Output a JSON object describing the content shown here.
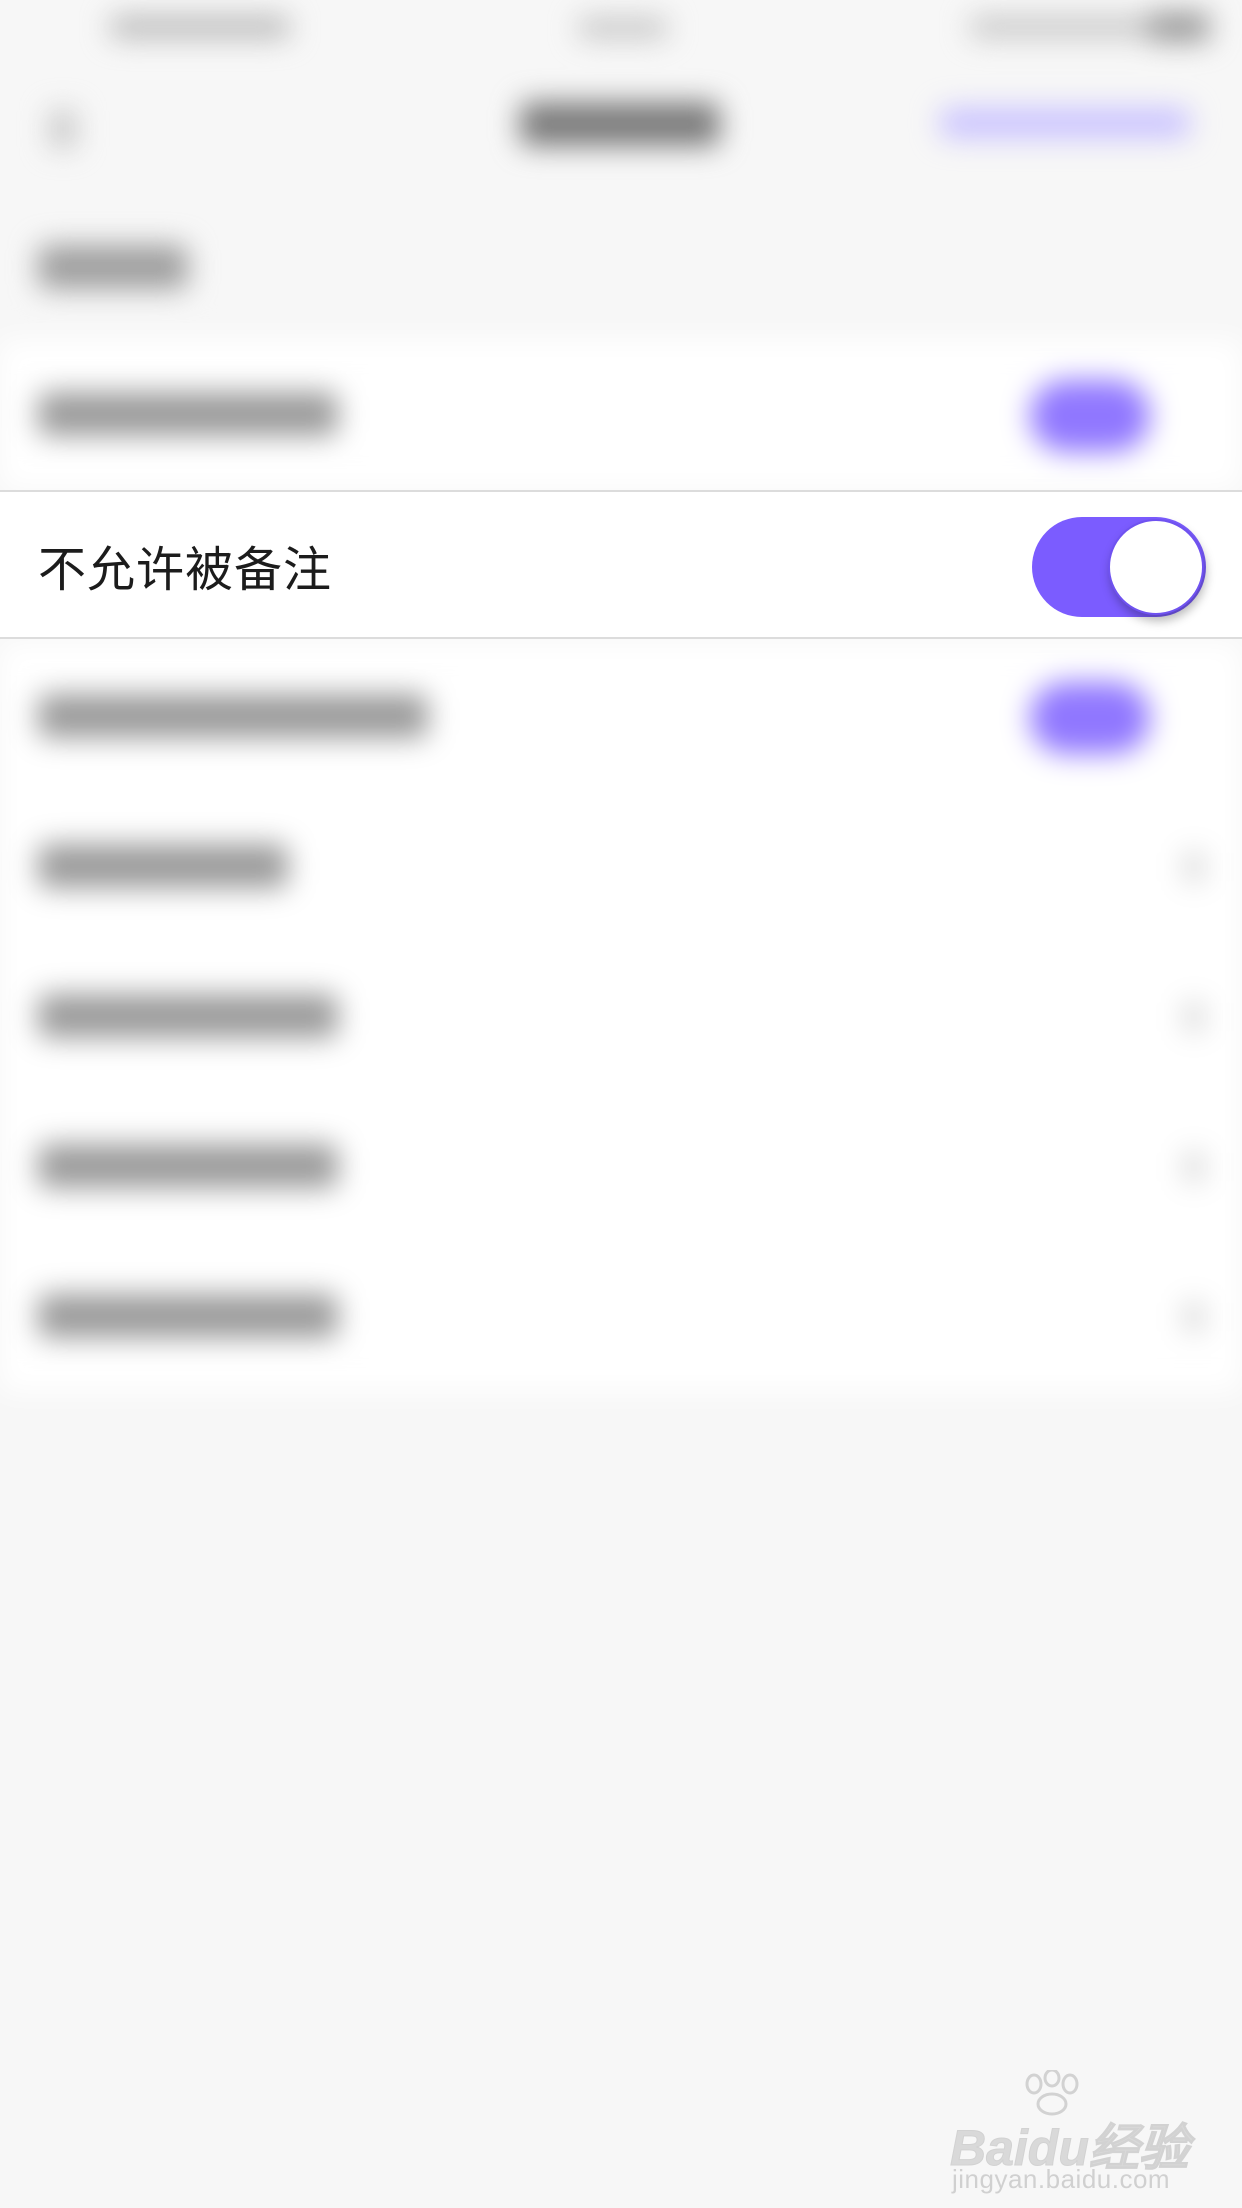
{
  "setting": {
    "label": "不允许被备注",
    "toggle_on": true
  },
  "watermark": {
    "brand": "Baidu经验",
    "url": "jingyan.baidu.com"
  },
  "colors": {
    "accent": "#7b5cff",
    "background": "#f7f7f7",
    "row_background": "#ffffff",
    "divider": "#dcdcdc",
    "label_text": "#1c1c1c",
    "watermark": "#d6d6d6"
  }
}
